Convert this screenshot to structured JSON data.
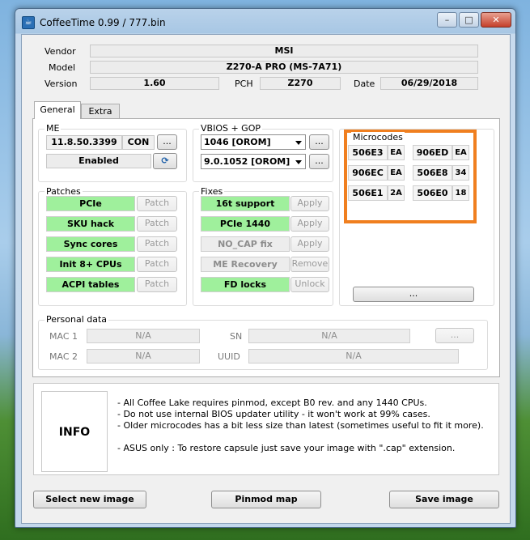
{
  "window": {
    "title": "CoffeeTime 0.99  /  777.bin",
    "icon": "coffee-icon"
  },
  "caption_buttons": {
    "minimize": "–",
    "maximize": "□",
    "close": "✕"
  },
  "header": {
    "vendor_label": "Vendor",
    "vendor": "MSI",
    "model_label": "Model",
    "model": "Z270-A PRO (MS-7A71)",
    "version_label": "Version",
    "version": "1.60",
    "pch_label": "PCH",
    "pch": "Z270",
    "date_label": "Date",
    "date": "06/29/2018"
  },
  "tabs": [
    {
      "label": "General"
    },
    {
      "label": "Extra"
    }
  ],
  "me": {
    "title": "ME",
    "version": "11.8.50.3399",
    "con_label": "CON",
    "more_label": "...",
    "status": "Enabled",
    "refresh_icon": "refresh-icon"
  },
  "vbios": {
    "title": "VBIOS + GOP",
    "vbios_value": "1046 [OROM]",
    "gop_value": "9.0.1052 [OROM]",
    "more_label": "..."
  },
  "microcodes": {
    "title": "Microcodes",
    "items": [
      {
        "cpuid": "506E3",
        "code": "EA"
      },
      {
        "cpuid": "906ED",
        "code": "EA"
      },
      {
        "cpuid": "906EC",
        "code": "EA"
      },
      {
        "cpuid": "506E8",
        "code": "34"
      },
      {
        "cpuid": "506E1",
        "code": "2A"
      },
      {
        "cpuid": "506E0",
        "code": "18"
      }
    ],
    "more_label": "...",
    "highlight_color": "#f07f1f"
  },
  "patches": {
    "title": "Patches",
    "items": [
      {
        "label": "PCIe",
        "action": "Patch"
      },
      {
        "label": "SKU hack",
        "action": "Patch"
      },
      {
        "label": "Sync cores",
        "action": "Patch"
      },
      {
        "label": "Init 8+ CPUs",
        "action": "Patch"
      },
      {
        "label": "ACPI tables",
        "action": "Patch"
      }
    ]
  },
  "fixes": {
    "title": "Fixes",
    "items": [
      {
        "label": "16t support",
        "action": "Apply"
      },
      {
        "label": "PCIe 1440",
        "action": "Apply"
      },
      {
        "label": "NO_CAP fix",
        "action": "Apply"
      },
      {
        "label": "ME Recovery",
        "action": "Remove"
      },
      {
        "label": "FD locks",
        "action": "Unlock"
      }
    ]
  },
  "personal": {
    "title": "Personal data",
    "mac1_label": "MAC 1",
    "mac1": "N/A",
    "mac2_label": "MAC 2",
    "mac2": "N/A",
    "sn_label": "SN",
    "sn": "N/A",
    "uuid_label": "UUID",
    "uuid": "N/A",
    "more_label": "..."
  },
  "info": {
    "title": "INFO",
    "lines": [
      "- All Coffee Lake requires pinmod, except B0 rev. and any 1440 CPUs.",
      "- Do not use internal BIOS updater utility - it won't work at 99% cases.",
      "- Older microcodes has a bit less size than latest (sometimes useful to fit it more).",
      "",
      "- ASUS only : To restore capsule just save your image with \".cap\" extension."
    ]
  },
  "footer": {
    "select_label": "Select new image",
    "pinmod_label": "Pinmod map",
    "save_label": "Save image"
  },
  "colors": {
    "active_green": "#9ff09c",
    "highlight": "#f07f1f"
  }
}
